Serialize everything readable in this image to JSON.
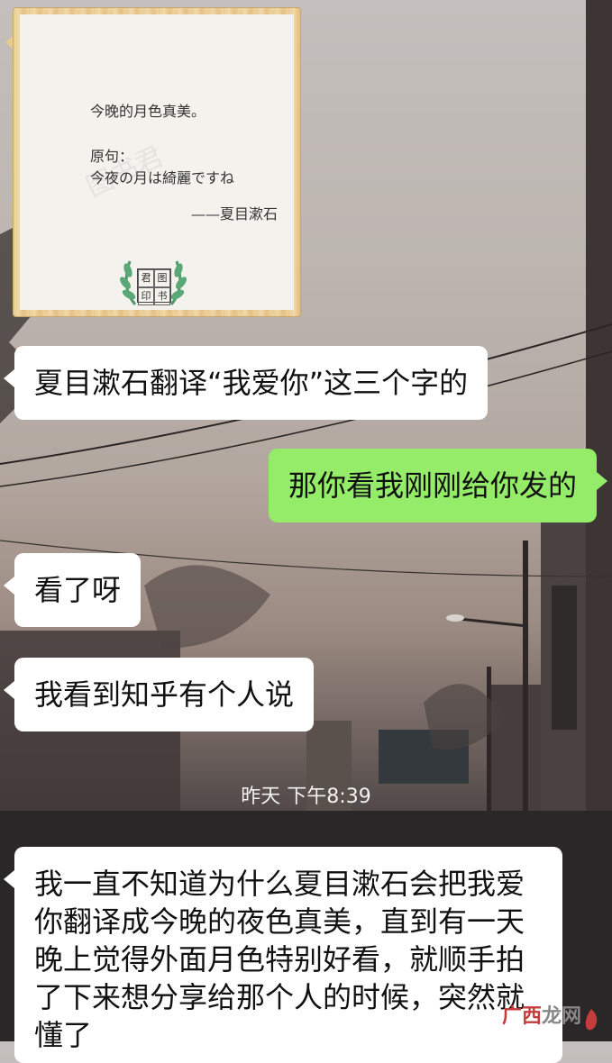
{
  "image_card": {
    "line1": "今晚的月色真美。",
    "line2": "原句：",
    "line3": "今夜の月は綺麗ですね",
    "line4": "——夏目漱石",
    "background_watermark": "图书君",
    "seal_chars": [
      "君",
      "图",
      "印",
      "书"
    ]
  },
  "messages": [
    {
      "side": "in",
      "text": "夏目漱石翻译“我爱你”这三个字的"
    },
    {
      "side": "out",
      "text": "那你看我刚刚给你发的"
    },
    {
      "side": "in",
      "text": "看了呀"
    },
    {
      "side": "in",
      "text": "我看到知乎有个人说"
    },
    {
      "side": "in",
      "text": "我一直不知道为什么夏目漱石会把我爱你翻译成今晚的夜色真美，直到有一天晚上觉得外面月色特别好看，就顺手拍了下来想分享给那个人的时候，突然就懂了"
    }
  ],
  "timestamp": "昨天 下午8:39",
  "watermark": {
    "part1": "广西",
    "part2": "龙网"
  },
  "colors": {
    "incoming": "#ffffff",
    "outgoing": "#95ec69",
    "card_frame": "#e9c992"
  }
}
